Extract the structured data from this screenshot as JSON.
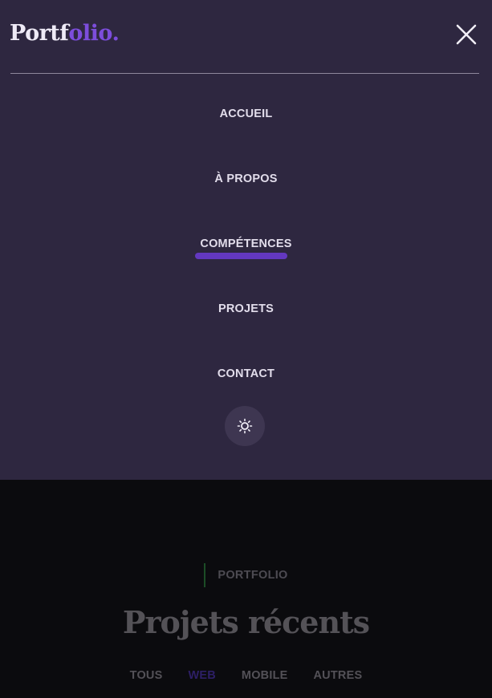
{
  "logo": {
    "main": "Portf",
    "accent": "olio."
  },
  "icons": {
    "close": "close-icon",
    "theme": "sun-icon"
  },
  "colors": {
    "menu_bg": "#2e2740",
    "accent": "#7c4ddb",
    "active_underline": "#6338c0",
    "page_bg": "#0b0b0e"
  },
  "menu": {
    "items": [
      {
        "label": "ACCUEIL",
        "active": false
      },
      {
        "label": "À PROPOS",
        "active": false
      },
      {
        "label": "COMPÉTENCES",
        "active": true
      },
      {
        "label": "PROJETS",
        "active": false
      },
      {
        "label": "CONTACT",
        "active": false
      }
    ]
  },
  "section": {
    "eyebrow": "PORTFOLIO",
    "title": "Projets récents",
    "filters": [
      {
        "label": "TOUS",
        "active": false
      },
      {
        "label": "WEB",
        "active": true
      },
      {
        "label": "MOBILE",
        "active": false
      },
      {
        "label": "AUTRES",
        "active": false
      }
    ]
  }
}
